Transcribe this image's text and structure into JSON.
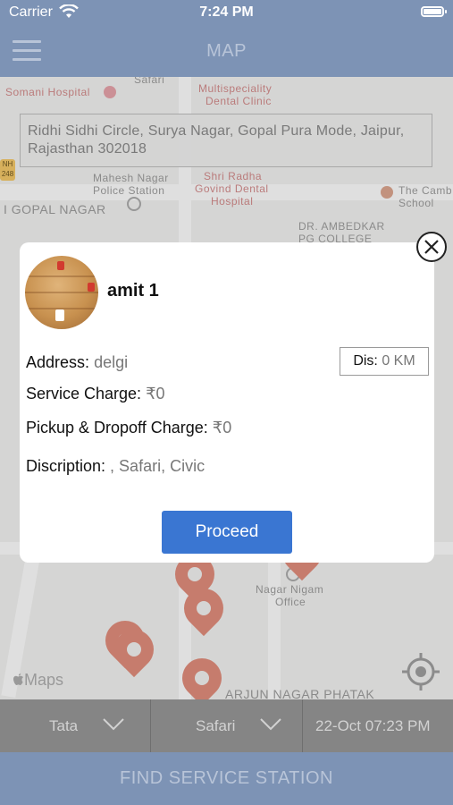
{
  "status_bar": {
    "carrier": "Carrier",
    "time": "7:24 PM"
  },
  "nav": {
    "title": "MAP"
  },
  "map": {
    "search_address": "Ridhi Sidhi Circle, Surya Nagar, Gopal Pura Mode, Jaipur, Rajasthan 302018",
    "labels": {
      "somani": "Somani Hospital",
      "multispeciality": "Multispeciality",
      "dental_clinic": "Dental Clinic",
      "mahesh_nagar": "Mahesh Nagar",
      "police_station": "Police Station",
      "shri_radha": "Shri Radha",
      "govind_dental": "Govind Dental",
      "hospital": "Hospital",
      "gopal_nagar": "I GOPAL NAGAR",
      "the_camb": "The Camb",
      "school": "School",
      "dr_ambedkar": "DR. AMBEDKAR",
      "pg_college": "PG COLLEGE",
      "nagar_nigam": "Nagar Nigam",
      "office": "Office",
      "arjun_nagar": "ARJUN NAGAR PHATAK",
      "nh": "NH",
      "nh_num": "248",
      "safari_top": "Safari"
    },
    "brand": "Maps"
  },
  "dialog": {
    "name": "amit 1",
    "address_label": "Address:",
    "address_value": "delgi",
    "distance_label": "Dis:",
    "distance_value": "0 KM",
    "service_label": "Service Charge:",
    "service_value": "₹0",
    "pickup_label": "Pickup & Dropoff Charge:",
    "pickup_value": "₹0",
    "description_label": "Discription:",
    "description_value": ", Safari, Civic",
    "proceed_label": "Proceed"
  },
  "filters": {
    "brand": "Tata",
    "model": "Safari",
    "datetime": "22-Oct 07:23 PM"
  },
  "footer": {
    "find_label": "FIND SERVICE STATION"
  },
  "colors": {
    "nav": "#7d93b5",
    "proceed": "#3a76d2",
    "pin": "#dd8b7a",
    "filter_bar": "#858585"
  },
  "icons": [
    "wifi-icon",
    "battery-icon",
    "menu-icon",
    "close-icon",
    "chevron-down-icon",
    "locate-icon",
    "map-pin-icon",
    "apple-logo-icon"
  ]
}
